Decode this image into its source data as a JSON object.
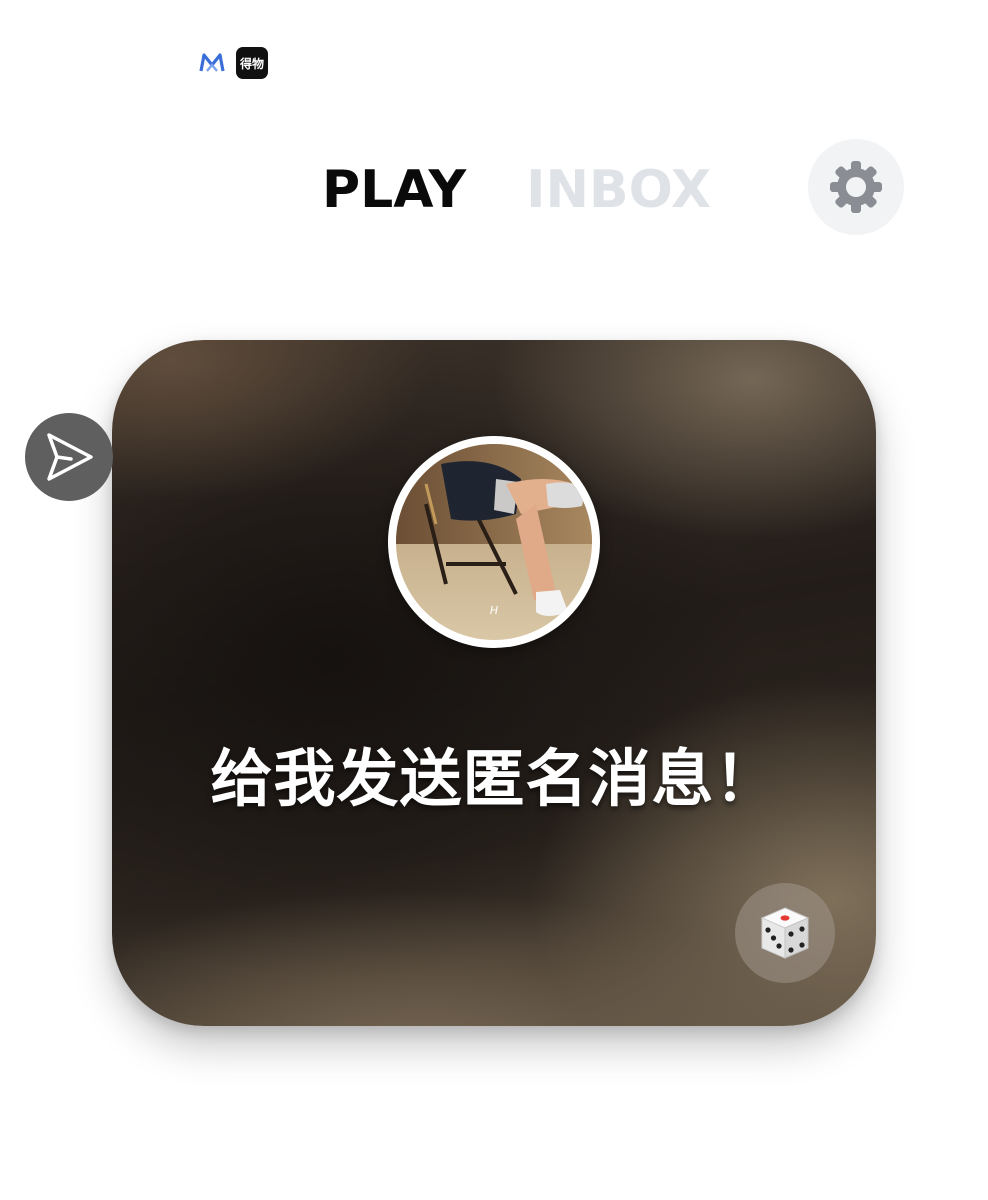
{
  "status_bar": {
    "icons": [
      {
        "name": "m-app-icon",
        "color": "#3a6fd8"
      },
      {
        "name": "dewu-app-icon",
        "label": "得物"
      }
    ]
  },
  "tabs": [
    {
      "label": "PLAY",
      "active": true
    },
    {
      "label": "INBOX",
      "active": false
    }
  ],
  "settings": {
    "icon": "gear-icon",
    "color": "#8a8d93"
  },
  "card": {
    "message": "给我发送匿名消息！",
    "avatar": {
      "icon": "profile-photo"
    },
    "dice_icon": "dice-icon",
    "share_icon": "paper-plane-icon"
  },
  "colors": {
    "tab_active": "#0a0a0a",
    "tab_inactive": "#dfe2e7",
    "settings_bg": "#f2f3f5",
    "share_bg": "#5f5f5f"
  }
}
